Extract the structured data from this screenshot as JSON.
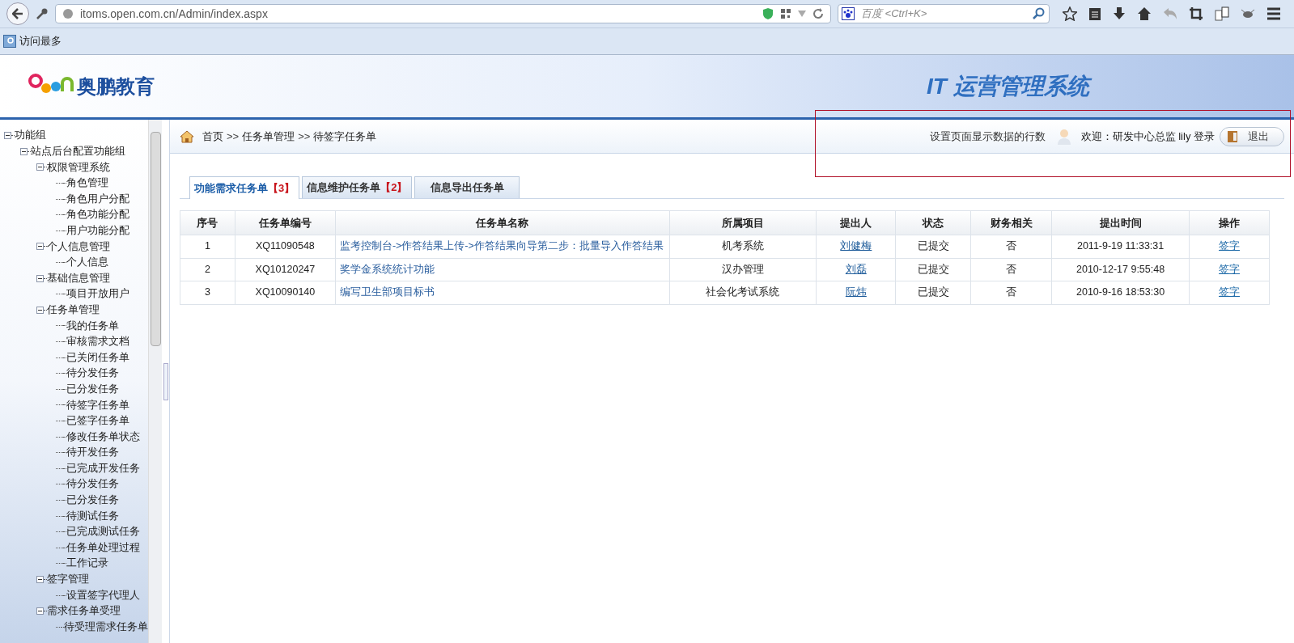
{
  "browser": {
    "url": "itoms.open.com.cn/Admin/index.aspx",
    "search_placeholder": "百度 <Ctrl+K>",
    "bookmarks": [
      "访问最多"
    ]
  },
  "header": {
    "logo_text": "奥鹏教育",
    "system_title": "IT 运营管理系统"
  },
  "sidebar": {
    "tree": [
      {
        "label": "功能组",
        "expanded": true,
        "children": [
          {
            "label": "站点后台配置功能组",
            "expanded": true,
            "children": [
              {
                "label": "权限管理系统",
                "expanded": true,
                "children": [
                  {
                    "label": "角色管理"
                  },
                  {
                    "label": "角色用户分配"
                  },
                  {
                    "label": "角色功能分配"
                  },
                  {
                    "label": "用户功能分配"
                  }
                ]
              },
              {
                "label": "个人信息管理",
                "expanded": true,
                "children": [
                  {
                    "label": "个人信息"
                  }
                ]
              },
              {
                "label": "基础信息管理",
                "expanded": true,
                "children": [
                  {
                    "label": "项目开放用户"
                  }
                ]
              },
              {
                "label": "任务单管理",
                "expanded": true,
                "children": [
                  {
                    "label": "我的任务单"
                  },
                  {
                    "label": "审核需求文档"
                  },
                  {
                    "label": "已关闭任务单"
                  },
                  {
                    "label": "待分发任务"
                  },
                  {
                    "label": "已分发任务"
                  },
                  {
                    "label": "待签字任务单"
                  },
                  {
                    "label": "已签字任务单"
                  },
                  {
                    "label": "修改任务单状态"
                  },
                  {
                    "label": "待开发任务"
                  },
                  {
                    "label": "已完成开发任务"
                  },
                  {
                    "label": "待分发任务"
                  },
                  {
                    "label": "已分发任务"
                  },
                  {
                    "label": "待测试任务"
                  },
                  {
                    "label": "已完成测试任务"
                  },
                  {
                    "label": "任务单处理过程"
                  },
                  {
                    "label": "工作记录"
                  }
                ]
              },
              {
                "label": "签字管理",
                "expanded": true,
                "children": [
                  {
                    "label": "设置签字代理人"
                  }
                ]
              },
              {
                "label": "需求任务单受理",
                "expanded": true,
                "children": [
                  {
                    "label": "待受理需求任务单"
                  }
                ]
              }
            ]
          }
        ]
      }
    ]
  },
  "breadcrumb": [
    "首页",
    ">>",
    "任务单管理",
    ">>",
    "待签字任务单"
  ],
  "topbar": {
    "row_setting_link": "设置页面显示数据的行数",
    "welcome": "欢迎：研发中心总监 lily 登录",
    "logout_button": "退出"
  },
  "tabs": [
    {
      "label": "功能需求任务单",
      "count": "【3】",
      "selected": true
    },
    {
      "label": "信息维护任务单",
      "count": "【2】",
      "selected": false
    },
    {
      "label": "信息导出任务单",
      "selected": false
    }
  ],
  "table": {
    "columns": [
      "序号",
      "任务单编号",
      "任务单名称",
      "所属项目",
      "提出人",
      "状态",
      "财务相关",
      "提出时间",
      "操作"
    ],
    "rows": [
      {
        "cells": [
          "1",
          "XQ11090548",
          "监考控制台->作答结果上传->作答结果向导第二步：批量导入作答结果",
          "机考系统",
          "刘健梅",
          "已提交",
          "否",
          "2011-9-19 11:33:31",
          "签字"
        ]
      },
      {
        "cells": [
          "2",
          "XQ10120247",
          "奖学金系统统计功能",
          "汉办管理",
          "刘磊",
          "已提交",
          "否",
          "2010-12-17 9:55:48",
          "签字"
        ]
      },
      {
        "cells": [
          "3",
          "XQ10090140",
          "编写卫生部项目标书",
          "社会化考试系统",
          "阮炜",
          "已提交",
          "否",
          "2010-9-16 18:53:30",
          "签字"
        ]
      }
    ]
  }
}
